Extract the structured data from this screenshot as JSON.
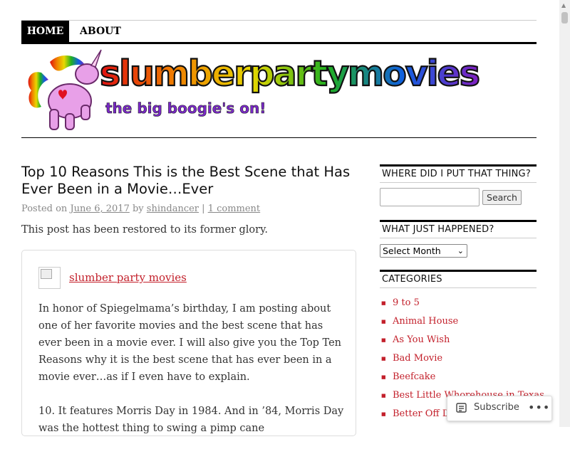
{
  "nav": {
    "home": "HOME",
    "about": "ABOUT"
  },
  "header": {
    "site_name": "slumberpartymovies",
    "tagline": "the big boogie's on!"
  },
  "post": {
    "title": "Top 10 Reasons This is the Best Scene that Has Ever Been in a Movie…Ever",
    "meta_prefix": "Posted on",
    "date": "June 6, 2017",
    "by": "by",
    "author": "shindancer",
    "sep": "|",
    "comments": "1 comment",
    "intro": "This post has been restored to its former glory."
  },
  "embed": {
    "site_link": "slumber party movies",
    "paragraph1": "In honor of Spiegelmama’s birthday, I am posting about one of her favorite movies and the best scene that has ever been in a movie ever.  I will also give you the Top Ten Reasons why it is the best scene that has ever been in a movie ever…as if  I even have to explain.",
    "paragraph2": "10. It features Morris Day in 1984. And in ’84,  Morris Day was the hottest thing to swing a pimp cane"
  },
  "sidebar": {
    "search_title": "WHERE DID I PUT THAT THING?",
    "search_button": "Search",
    "archive_title": "WHAT JUST HAPPENED?",
    "archive_select": "Select Month",
    "categories_title": "CATEGORIES",
    "categories": [
      "9 to 5",
      "Animal House",
      "As You Wish",
      "Bad Movie",
      "Beefcake",
      "Best Little Whorehouse in Texas",
      "Better Off Dead"
    ]
  },
  "subscribe": {
    "label": "Subscribe",
    "more": "•••"
  },
  "colors": {
    "accent": "#c3202b",
    "nav_bg": "#000000"
  }
}
